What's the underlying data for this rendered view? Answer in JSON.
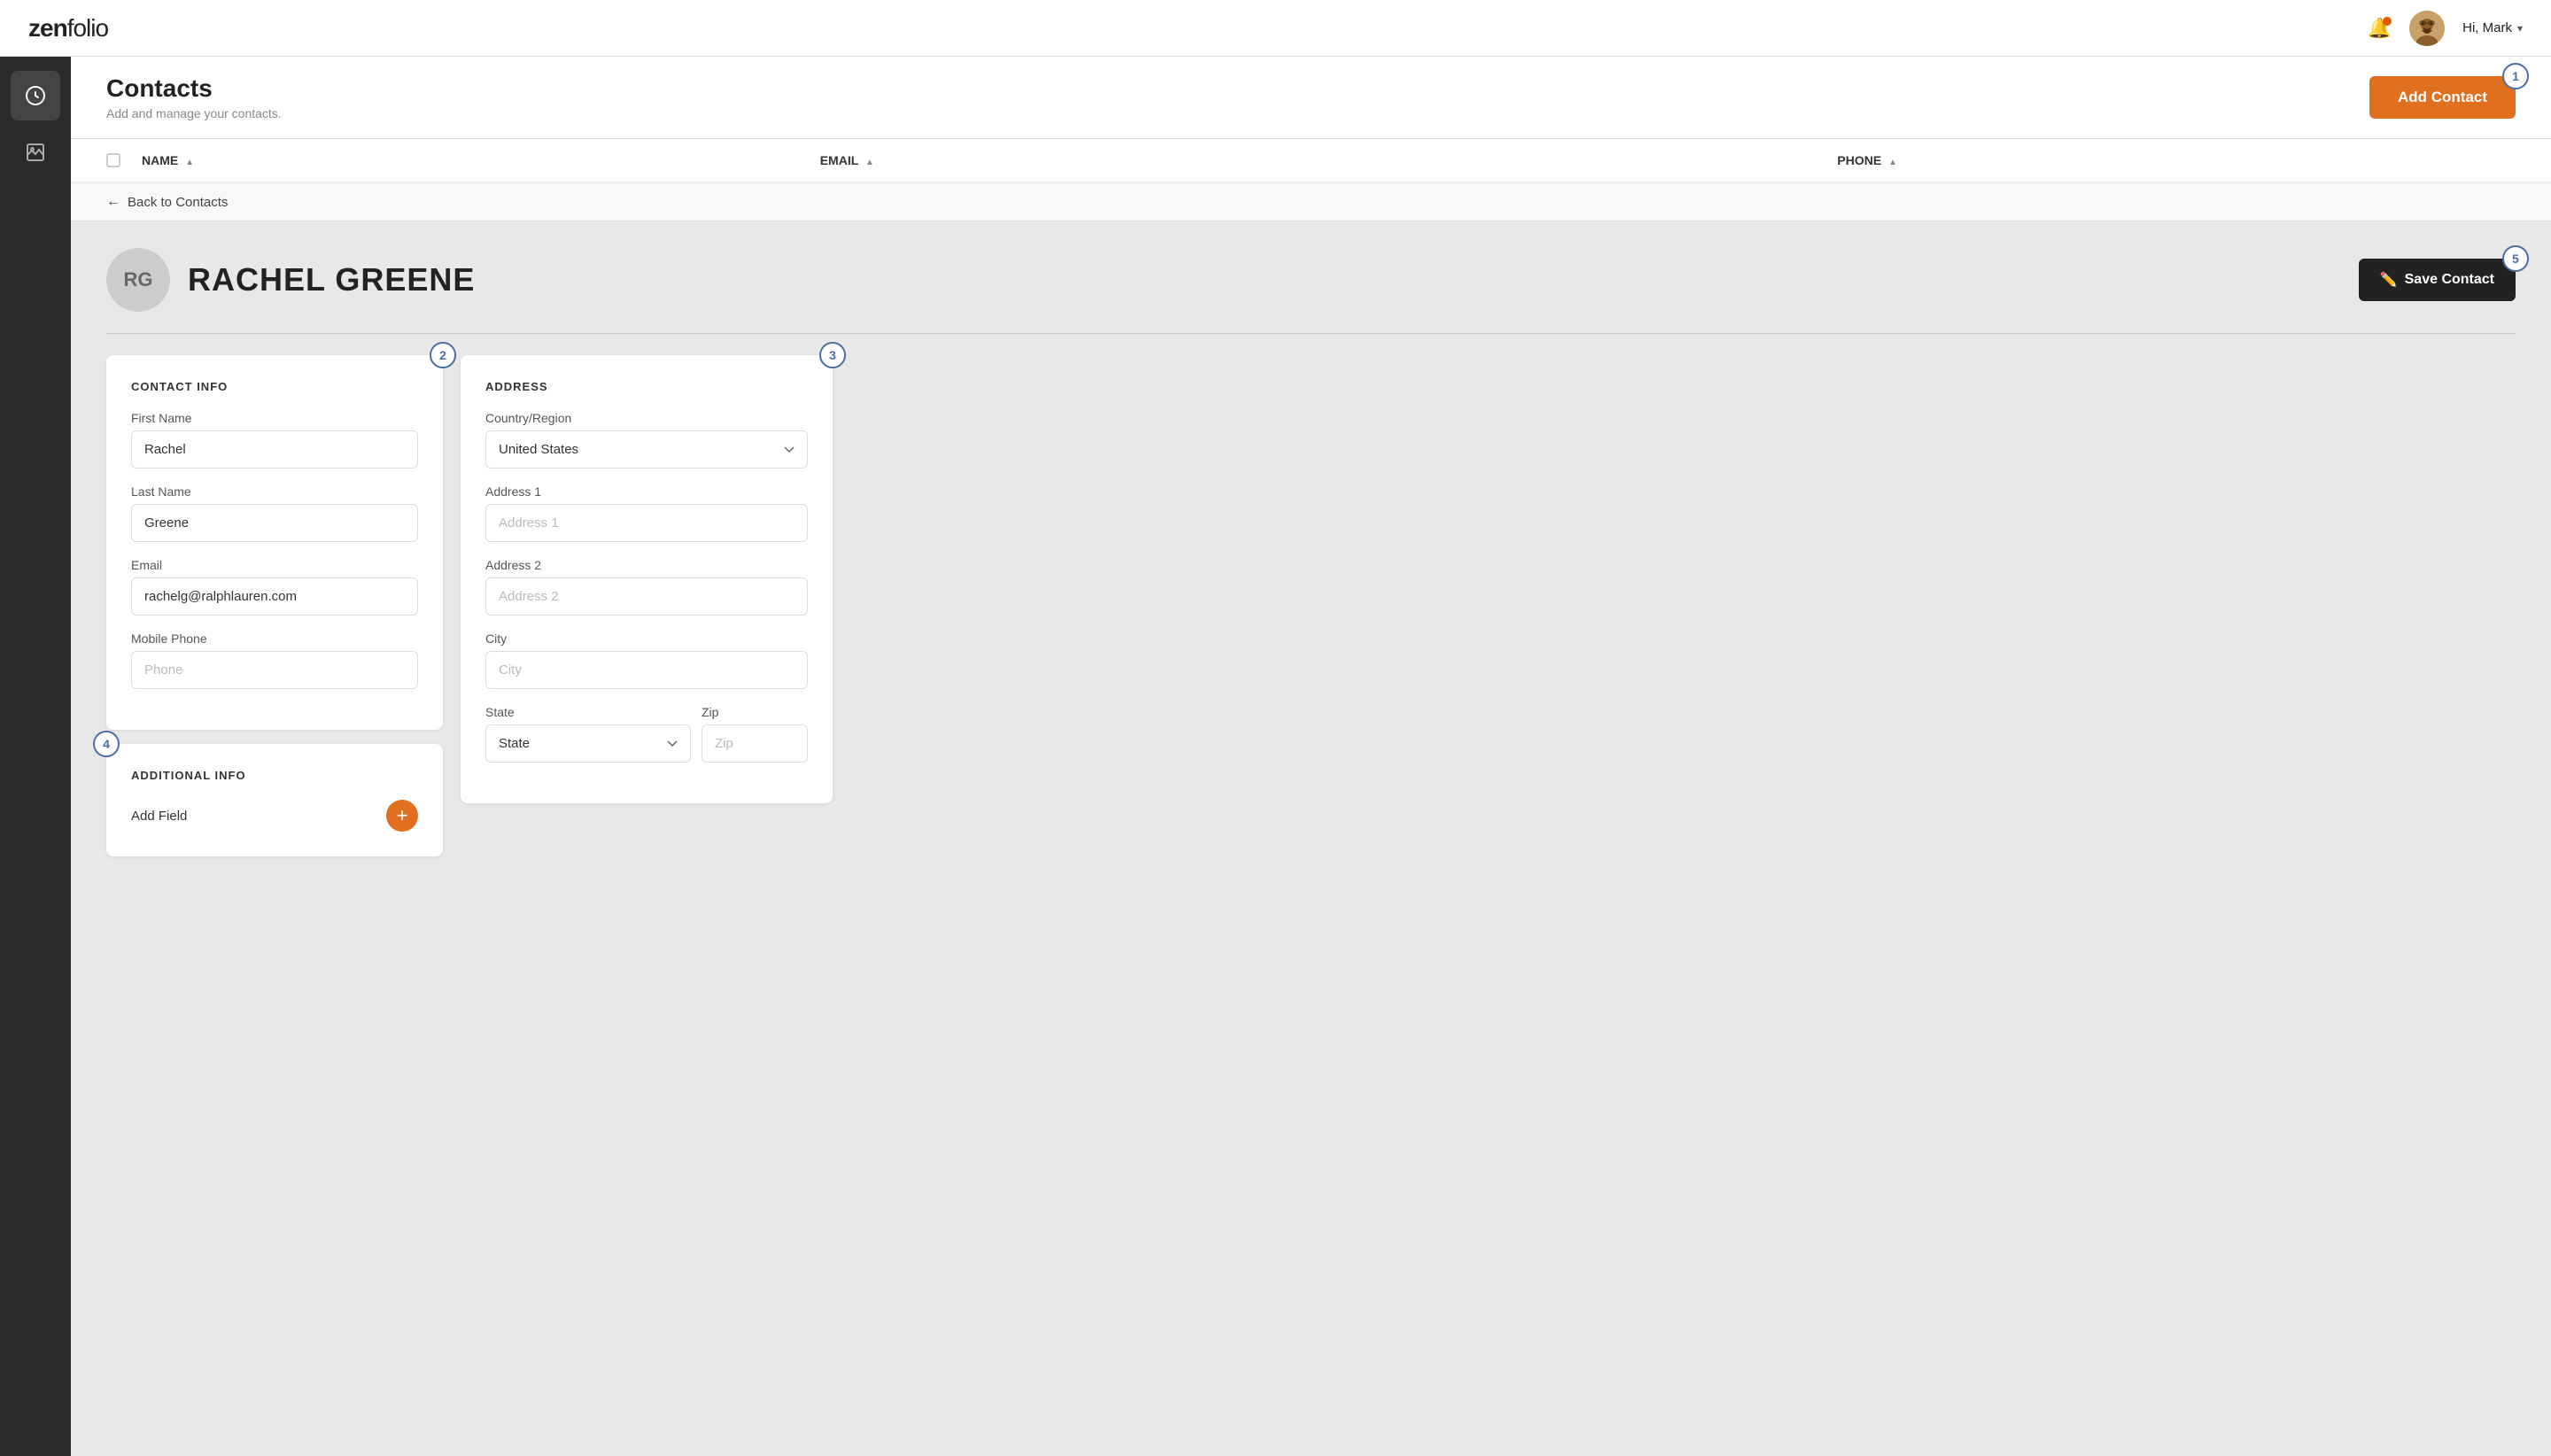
{
  "app": {
    "logo": "zenfolio"
  },
  "topnav": {
    "hi_label": "Hi, Mark",
    "chevron": "▾"
  },
  "header": {
    "title": "Contacts",
    "subtitle": "Add and manage your contacts.",
    "add_button": "Add Contact"
  },
  "table": {
    "col_name": "NAME",
    "col_email": "EMAIL",
    "col_phone": "PHONE"
  },
  "back": {
    "label": "Back to Contacts"
  },
  "contact": {
    "initials": "RG",
    "name": "RACHEL GREENE",
    "save_button": "Save Contact"
  },
  "contact_info": {
    "section_title": "CONTACT INFO",
    "first_name_label": "First Name",
    "first_name_value": "Rachel",
    "last_name_label": "Last Name",
    "last_name_value": "Greene",
    "email_label": "Email",
    "email_value": "rachelg@ralphlauren.com",
    "mobile_label": "Mobile Phone",
    "mobile_placeholder": "Phone"
  },
  "address": {
    "section_title": "ADDRESS",
    "country_label": "Country/Region",
    "country_value": "United States",
    "address1_label": "Address 1",
    "address1_placeholder": "Address 1",
    "address2_label": "Address 2",
    "address2_placeholder": "Address 2",
    "city_label": "City",
    "city_placeholder": "City",
    "state_label": "State",
    "state_placeholder": "State",
    "zip_label": "Zip",
    "zip_placeholder": "Zip"
  },
  "additional": {
    "section_title": "ADDITIONAL INFO",
    "add_field_label": "Add Field"
  },
  "badges": {
    "one": "1",
    "two": "2",
    "three": "3",
    "four": "4",
    "five": "5"
  },
  "colors": {
    "orange": "#e07020",
    "dark": "#222222",
    "badge_border": "#4a6fa5"
  }
}
